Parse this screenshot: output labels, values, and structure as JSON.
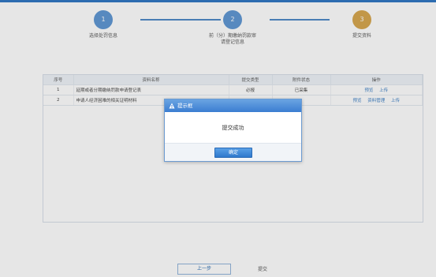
{
  "steps": [
    {
      "num": "1",
      "label": "选择处罚信息",
      "status": "done"
    },
    {
      "num": "2",
      "label": "前（分）期缴纳罚款审",
      "label2": "请登记信息",
      "status": "done"
    },
    {
      "num": "3",
      "label": "提交资料",
      "status": "pending"
    }
  ],
  "table": {
    "headers": [
      "序号",
      "资料名称",
      "提交类型",
      "附件状态",
      "操作"
    ],
    "rows": [
      {
        "no": "1",
        "name": "延期或者分期缴纳罚款申请登记表",
        "type": "必报",
        "status": "已采集",
        "actions": [
          "预览",
          "上传"
        ]
      },
      {
        "no": "2",
        "name": "申请人经济困难的相关证明材料",
        "type": "",
        "status": "",
        "actions": [
          "预览",
          "资料管理",
          "上传"
        ]
      }
    ]
  },
  "buttons": {
    "prev": "上一步",
    "submit": "提交"
  },
  "modal": {
    "title": "提示框",
    "message": "提交成功",
    "ok": "确定"
  },
  "colors": {
    "accent": "#2f78cc",
    "step_active": "#5b95d3",
    "step_pending": "#d6a54a"
  }
}
